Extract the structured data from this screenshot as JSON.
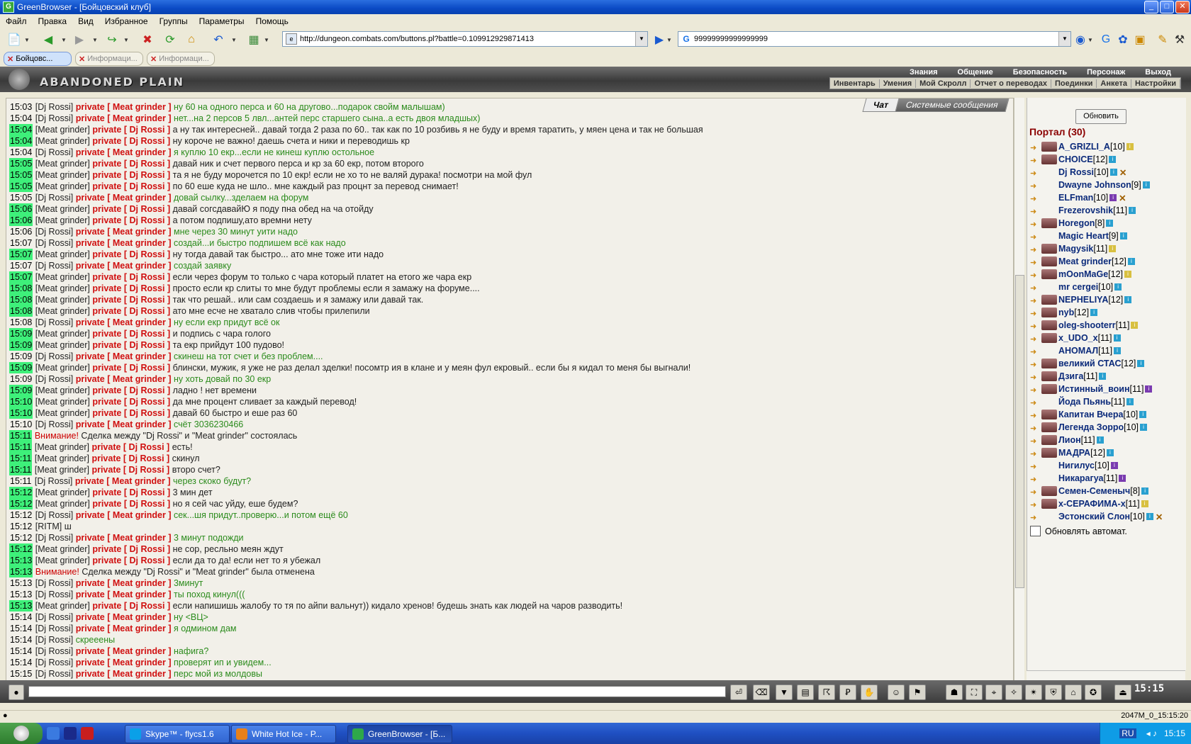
{
  "window": {
    "title": "GreenBrowser - [Бойцовский клуб]"
  },
  "menu": [
    "Файл",
    "Правка",
    "Вид",
    "Избранное",
    "Группы",
    "Параметры",
    "Помощь"
  ],
  "address": {
    "url": "http://dungeon.combats.com/buttons.pl?battle=0.109912929871413"
  },
  "search": {
    "value": "99999999999999999"
  },
  "tabs": [
    {
      "label": "Бойцовс..."
    },
    {
      "label": "Информаци..."
    },
    {
      "label": "Информаци..."
    }
  ],
  "banner": {
    "title": "ABANDONED PLAIN",
    "nav_top": [
      "Знания",
      "Общение",
      "Безопасность",
      "Персонаж",
      "Выход"
    ],
    "nav_bottom": [
      "Инвентарь",
      "Умения",
      "Мой Скролл",
      "Отчет о переводах",
      "Поединки",
      "Анкета",
      "Настройки"
    ]
  },
  "chat_tabs": {
    "chat": "Чат",
    "system": "Системные сообщения"
  },
  "chat": [
    {
      "time": "15:03",
      "hl": false,
      "from": "[Dj Rossi]",
      "priv": "private [ Meat grinder ]",
      "msg": "ну 60 на одного перса и 60 на другово...подарок свойм малышам)",
      "mc": "g"
    },
    {
      "time": "15:04",
      "hl": false,
      "from": "[Dj Rossi]",
      "priv": "private [ Meat grinder ]",
      "msg": "нет...на 2 персов 5 лвл...антей перс старшего сына..а есть двоя младшых)",
      "mc": "g"
    },
    {
      "time": "15:04",
      "hl": true,
      "from": "[Meat grinder]",
      "priv": "private [ Dj Rossi ]",
      "msg": "а ну так интересней.. давай тогда 2 раза по 60.. так как по 10 розбивь я не буду и время таратить, у мяен цена и так не большая",
      "mc": "b"
    },
    {
      "time": "15:04",
      "hl": true,
      "from": "[Meat grinder]",
      "priv": "private [ Dj Rossi ]",
      "msg": "ну короче не важно! даешь счета и ники и переводишь кр",
      "mc": "b"
    },
    {
      "time": "15:04",
      "hl": false,
      "from": "[Dj Rossi]",
      "priv": "private [ Meat grinder ]",
      "msg": "я куплю 10 екр...если не кинеш куплю остольное",
      "mc": "g"
    },
    {
      "time": "15:05",
      "hl": true,
      "from": "[Meat grinder]",
      "priv": "private [ Dj Rossi ]",
      "msg": "давай ник и счет первого перса и кр за 60 екр, потом второго",
      "mc": "b"
    },
    {
      "time": "15:05",
      "hl": true,
      "from": "[Meat grinder]",
      "priv": "private [ Dj Rossi ]",
      "msg": "та я не буду морочется по 10 екр! если не хо то не валяй дурака! посмотри на мой фул",
      "mc": "b"
    },
    {
      "time": "15:05",
      "hl": true,
      "from": "[Meat grinder]",
      "priv": "private [ Dj Rossi ]",
      "msg": "по 60 еше куда не шло.. мне каждый раз процнт за перевод снимает!",
      "mc": "b"
    },
    {
      "time": "15:05",
      "hl": false,
      "from": "[Dj Rossi]",
      "priv": "private [ Meat grinder ]",
      "msg": "довай сылку...зделаем на форум",
      "mc": "g"
    },
    {
      "time": "15:06",
      "hl": true,
      "from": "[Meat grinder]",
      "priv": "private [ Dj Rossi ]",
      "msg": "давай согсдавайЮ я поду пна обед на ча отойду",
      "mc": "b"
    },
    {
      "time": "15:06",
      "hl": true,
      "from": "[Meat grinder]",
      "priv": "private [ Dj Rossi ]",
      "msg": "а потом подпишу,ато времни нету",
      "mc": "b"
    },
    {
      "time": "15:06",
      "hl": false,
      "from": "[Dj Rossi]",
      "priv": "private [ Meat grinder ]",
      "msg": "мне через 30 минут уити надо",
      "mc": "g"
    },
    {
      "time": "15:07",
      "hl": false,
      "from": "[Dj Rossi]",
      "priv": "private [ Meat grinder ]",
      "msg": "создай...и быстро подпишем всё как надо",
      "mc": "g"
    },
    {
      "time": "15:07",
      "hl": true,
      "from": "[Meat grinder]",
      "priv": "private [ Dj Rossi ]",
      "msg": "ну тогда давай так быстро... ато мне тоже ити надо",
      "mc": "b"
    },
    {
      "time": "15:07",
      "hl": false,
      "from": "[Dj Rossi]",
      "priv": "private [ Meat grinder ]",
      "msg": "создай заявку",
      "mc": "g"
    },
    {
      "time": "15:07",
      "hl": true,
      "from": "[Meat grinder]",
      "priv": "private [ Dj Rossi ]",
      "msg": "если через форум то только с чара который платет на етого же чара екр",
      "mc": "b"
    },
    {
      "time": "15:08",
      "hl": true,
      "from": "[Meat grinder]",
      "priv": "private [ Dj Rossi ]",
      "msg": "просто если кр слиты то мне будут проблемы если я замажу на форуме....",
      "mc": "b"
    },
    {
      "time": "15:08",
      "hl": true,
      "from": "[Meat grinder]",
      "priv": "private [ Dj Rossi ]",
      "msg": "так что решай.. или сам создаешь и я замажу или давай так.",
      "mc": "b"
    },
    {
      "time": "15:08",
      "hl": true,
      "from": "[Meat grinder]",
      "priv": "private [ Dj Rossi ]",
      "msg": "ато мне есче не хватало слив чтобы прилепили",
      "mc": "b"
    },
    {
      "time": "15:08",
      "hl": false,
      "from": "[Dj Rossi]",
      "priv": "private [ Meat grinder ]",
      "msg": "ну если екр придут всё ок",
      "mc": "g"
    },
    {
      "time": "15:09",
      "hl": true,
      "from": "[Meat grinder]",
      "priv": "private [ Dj Rossi ]",
      "msg": "и подпись с чара голого",
      "mc": "b"
    },
    {
      "time": "15:09",
      "hl": true,
      "from": "[Meat grinder]",
      "priv": "private [ Dj Rossi ]",
      "msg": "та екр прийдут 100 пудово!",
      "mc": "b"
    },
    {
      "time": "15:09",
      "hl": false,
      "from": "[Dj Rossi]",
      "priv": "private [ Meat grinder ]",
      "msg": "скинеш на тот счет и без проблем....",
      "mc": "g"
    },
    {
      "time": "15:09",
      "hl": true,
      "from": "[Meat grinder]",
      "priv": "private [ Dj Rossi ]",
      "msg": "блински, мужик, я уже не раз делал зделки! посомтр ия в клане и у меян фул екровый.. если бы я кидал то меня бы выгнали!",
      "mc": "b"
    },
    {
      "time": "15:09",
      "hl": false,
      "from": "[Dj Rossi]",
      "priv": "private [ Meat grinder ]",
      "msg": "ну хоть довай по 30 екр",
      "mc": "g"
    },
    {
      "time": "15:09",
      "hl": true,
      "from": "[Meat grinder]",
      "priv": "private [ Dj Rossi ]",
      "msg": "ладно ! нет времени",
      "mc": "b"
    },
    {
      "time": "15:10",
      "hl": true,
      "from": "[Meat grinder]",
      "priv": "private [ Dj Rossi ]",
      "msg": "да мне процент сливает за каждый перевод!",
      "mc": "b"
    },
    {
      "time": "15:10",
      "hl": true,
      "from": "[Meat grinder]",
      "priv": "private [ Dj Rossi ]",
      "msg": "давай 60 быстро и еше раз 60",
      "mc": "b"
    },
    {
      "time": "15:10",
      "hl": false,
      "from": "[Dj Rossi]",
      "priv": "private [ Meat grinder ]",
      "msg": "счёт 3036230466",
      "mc": "g"
    },
    {
      "time": "15:11",
      "hl": true,
      "from": "",
      "priv": "",
      "warn": "Внимание!",
      "msg": "Сделка между \"Dj Rossi\" и \"Meat grinder\" состоялась",
      "mc": "b"
    },
    {
      "time": "15:11",
      "hl": true,
      "from": "[Meat grinder]",
      "priv": "private [ Dj Rossi ]",
      "msg": "есть!",
      "mc": "b"
    },
    {
      "time": "15:11",
      "hl": true,
      "from": "[Meat grinder]",
      "priv": "private [ Dj Rossi ]",
      "msg": "скинул",
      "mc": "b"
    },
    {
      "time": "15:11",
      "hl": true,
      "from": "[Meat grinder]",
      "priv": "private [ Dj Rossi ]",
      "msg": "второ счет?",
      "mc": "b"
    },
    {
      "time": "15:11",
      "hl": false,
      "from": "[Dj Rossi]",
      "priv": "private [ Meat grinder ]",
      "msg": "через скоко будут?",
      "mc": "g"
    },
    {
      "time": "15:12",
      "hl": true,
      "from": "[Meat grinder]",
      "priv": "private [ Dj Rossi ]",
      "msg": "3 мин дет",
      "mc": "b"
    },
    {
      "time": "15:12",
      "hl": true,
      "from": "[Meat grinder]",
      "priv": "private [ Dj Rossi ]",
      "msg": "но я сей час уйду, еше будем?",
      "mc": "b"
    },
    {
      "time": "15:12",
      "hl": false,
      "from": "[Dj Rossi]",
      "priv": "private [ Meat grinder ]",
      "msg": "сек...шя придут..проверю...и потом ещё 60",
      "mc": "g"
    },
    {
      "time": "15:12",
      "hl": false,
      "from": "[RITM]",
      "priv": "",
      "msg": "ш",
      "mc": "b"
    },
    {
      "time": "15:12",
      "hl": false,
      "from": "[Dj Rossi]",
      "priv": "private [ Meat grinder ]",
      "msg": "3 минут подожди",
      "mc": "g"
    },
    {
      "time": "15:12",
      "hl": true,
      "from": "[Meat grinder]",
      "priv": "private [ Dj Rossi ]",
      "msg": "не сор, ресльно меян ждут",
      "mc": "b"
    },
    {
      "time": "15:13",
      "hl": true,
      "from": "[Meat grinder]",
      "priv": "private [ Dj Rossi ]",
      "msg": "если да то да! если нет то я убежал",
      "mc": "b"
    },
    {
      "time": "15:13",
      "hl": true,
      "from": "",
      "priv": "",
      "warn": "Внимание!",
      "msg": "Сделка между \"Dj Rossi\" и \"Meat grinder\" была отменена",
      "mc": "b"
    },
    {
      "time": "15:13",
      "hl": false,
      "from": "[Dj Rossi]",
      "priv": "private [ Meat grinder ]",
      "msg": "3минут",
      "mc": "g"
    },
    {
      "time": "15:13",
      "hl": false,
      "from": "[Dj Rossi]",
      "priv": "private [ Meat grinder ]",
      "msg": "ты поход кинул(((",
      "mc": "g"
    },
    {
      "time": "15:13",
      "hl": true,
      "from": "[Meat grinder]",
      "priv": "private [ Dj Rossi ]",
      "msg": "если напишишь жалобу то тя по айпи вальнут)) кидало хренов! будешь знать как людей на чаров разводить!",
      "mc": "b"
    },
    {
      "time": "15:14",
      "hl": false,
      "from": "[Dj Rossi]",
      "priv": "private [ Meat grinder ]",
      "msg": "ну <ВЦ>",
      "mc": "g"
    },
    {
      "time": "15:14",
      "hl": false,
      "from": "[Dj Rossi]",
      "priv": "private [ Meat grinder ]",
      "msg": "я одмином дам",
      "mc": "g"
    },
    {
      "time": "15:14",
      "hl": false,
      "from": "[Dj Rossi]",
      "priv": "",
      "msg": "скрееены",
      "mc": "g"
    },
    {
      "time": "15:14",
      "hl": false,
      "from": "[Dj Rossi]",
      "priv": "private [ Meat grinder ]",
      "msg": "нафига?",
      "mc": "g"
    },
    {
      "time": "15:14",
      "hl": false,
      "from": "[Dj Rossi]",
      "priv": "private [ Meat grinder ]",
      "msg": "проверят ип и увидем...",
      "mc": "g"
    },
    {
      "time": "15:15",
      "hl": false,
      "from": "[Dj Rossi]",
      "priv": "private [ Meat grinder ]",
      "msg": "перс мой из молдовы",
      "mc": "g"
    }
  ],
  "sidebar": {
    "refresh_label": "Обновить",
    "portal_title": "Портал (30)",
    "users": [
      {
        "name": "A_GRIZLI_A",
        "level": "[10]",
        "info": "y",
        "avatar": true
      },
      {
        "name": "CHOICE",
        "level": "[12]",
        "info": "b",
        "avatar": true
      },
      {
        "name": "Dj Rossi",
        "level": "[10]",
        "info": "b",
        "avatar": false,
        "mark": "✕"
      },
      {
        "name": "Dwayne Johnson",
        "level": "[9]",
        "info": "b",
        "avatar": false
      },
      {
        "name": "ELFman",
        "level": "[10]",
        "info": "p",
        "avatar": false,
        "mark": "✕"
      },
      {
        "name": "Frezerovshik",
        "level": "[11]",
        "info": "b",
        "avatar": false
      },
      {
        "name": "Horegon",
        "level": "[8]",
        "info": "b",
        "avatar": true
      },
      {
        "name": "Magic Heart",
        "level": "[9]",
        "info": "b",
        "avatar": false
      },
      {
        "name": "Magysik",
        "level": "[11]",
        "info": "y",
        "avatar": true
      },
      {
        "name": "Meat grinder",
        "level": "[12]",
        "info": "b",
        "avatar": true
      },
      {
        "name": "mOonMaGe",
        "level": "[12]",
        "info": "y",
        "avatar": true
      },
      {
        "name": "mr cergei",
        "level": "[10]",
        "info": "b",
        "avatar": false
      },
      {
        "name": "NEPHELIYA",
        "level": "[12]",
        "info": "b",
        "avatar": true
      },
      {
        "name": "nyb",
        "level": "[12]",
        "info": "b",
        "avatar": true
      },
      {
        "name": "oleg-shooterr",
        "level": "[11]",
        "info": "y",
        "avatar": true
      },
      {
        "name": "x_UDO_x",
        "level": "[11]",
        "info": "b",
        "avatar": true
      },
      {
        "name": "АНОМАЛ",
        "level": "[11]",
        "info": "b",
        "avatar": false
      },
      {
        "name": "великий СТАС",
        "level": "[12]",
        "info": "b",
        "avatar": true
      },
      {
        "name": "Дзига",
        "level": "[11]",
        "info": "b",
        "avatar": true
      },
      {
        "name": "Истинный_воин",
        "level": "[11]",
        "info": "p",
        "avatar": true
      },
      {
        "name": "Йода Пьянь",
        "level": "[11]",
        "info": "b",
        "avatar": false
      },
      {
        "name": "Капитан Вчера",
        "level": "[10]",
        "info": "b",
        "avatar": true
      },
      {
        "name": "Легенда Зорро",
        "level": "[10]",
        "info": "b",
        "avatar": true
      },
      {
        "name": "Лион",
        "level": "[11]",
        "info": "b",
        "avatar": true
      },
      {
        "name": "МАДРА",
        "level": "[12]",
        "info": "b",
        "avatar": true
      },
      {
        "name": "Нигилус",
        "level": "[10]",
        "info": "p",
        "avatar": false
      },
      {
        "name": "Никарагуа",
        "level": "[11]",
        "info": "p",
        "avatar": false
      },
      {
        "name": "Семен-Семеныч",
        "level": "[8]",
        "info": "b",
        "avatar": true
      },
      {
        "name": "х-СЕРАФИМА-х",
        "level": "[11]",
        "info": "y",
        "avatar": true
      },
      {
        "name": "Эстонский Слон",
        "level": "[10]",
        "info": "b",
        "avatar": false,
        "mark": "✕"
      }
    ],
    "auto_label": "Обновлять автомат."
  },
  "bottom": {
    "clock": "15:15"
  },
  "statusbar": {
    "right_text": "2047M_0_15:15:20"
  },
  "taskbar": {
    "items": [
      {
        "label": "Skype™ - flycs1.6",
        "color": "#0aa0e8"
      },
      {
        "label": "White Hot Ice - P...",
        "color": "#e8801a"
      },
      {
        "label": "GreenBrowser - [Б...",
        "color": "#2ea84a",
        "active": true
      }
    ],
    "lang": "RU",
    "time": "15:15"
  }
}
